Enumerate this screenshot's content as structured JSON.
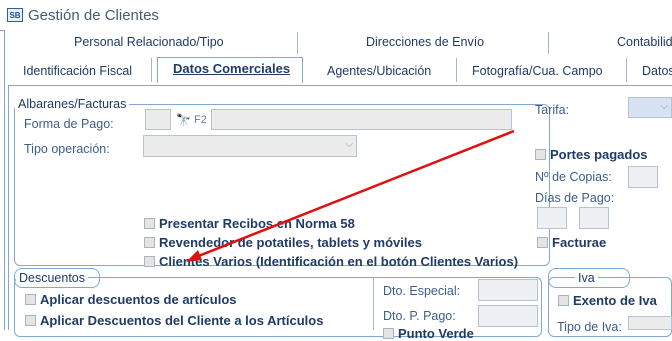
{
  "window": {
    "title": "Gestión de Clientes",
    "icon": "sb-app-icon"
  },
  "tabs_row1": [
    "Personal Relacionado/Tipo",
    "Direcciones de Envío",
    "Contabilidad"
  ],
  "tabs_row2": [
    "Identificación Fiscal",
    "Datos Comerciales",
    "Agentes/Ubicación",
    "Fotografía/Cua. Campo",
    "Datos"
  ],
  "active_tab": "Datos Comerciales",
  "albaranes": {
    "group_label": "Albaranes/Facturas",
    "forma_pago_label": "Forma de Pago:",
    "forma_pago_code": "",
    "forma_pago_key": "F2",
    "forma_pago_desc": "",
    "tipo_operacion_label": "Tipo operación:",
    "tipo_operacion_value": "",
    "presentar_recibos": "Presentar Recibos en Norma 58",
    "revendedor": "Revendedor de potatiles, tablets y móviles",
    "clientes_varios": "Clientes Varios (Identificación en el botón Clientes Varios)"
  },
  "right_panel": {
    "tarifa_label": "Tarifa:",
    "portes_pagados": "Portes pagados",
    "copias_label": "Nº de Copias:",
    "dias_pago_label": "Días de Pago:",
    "facturae": "Facturae"
  },
  "descuentos": {
    "group_label": "Descuentos",
    "aplicar_articulos": "Aplicar descuentos de artículos",
    "aplicar_cliente": "Aplicar Descuentos del Cliente a los Artículos",
    "dto_especial_label": "Dto. Especial:",
    "dto_p_pago_label": "Dto. P. Pago:",
    "punto_verde_partial": "Punto Verde"
  },
  "iva": {
    "group_label": "Iva",
    "exento": "Exento de Iva",
    "tipo_iva_label": "Tipo de Iva:"
  },
  "annotation": {
    "arrow_color": "#e01010"
  }
}
